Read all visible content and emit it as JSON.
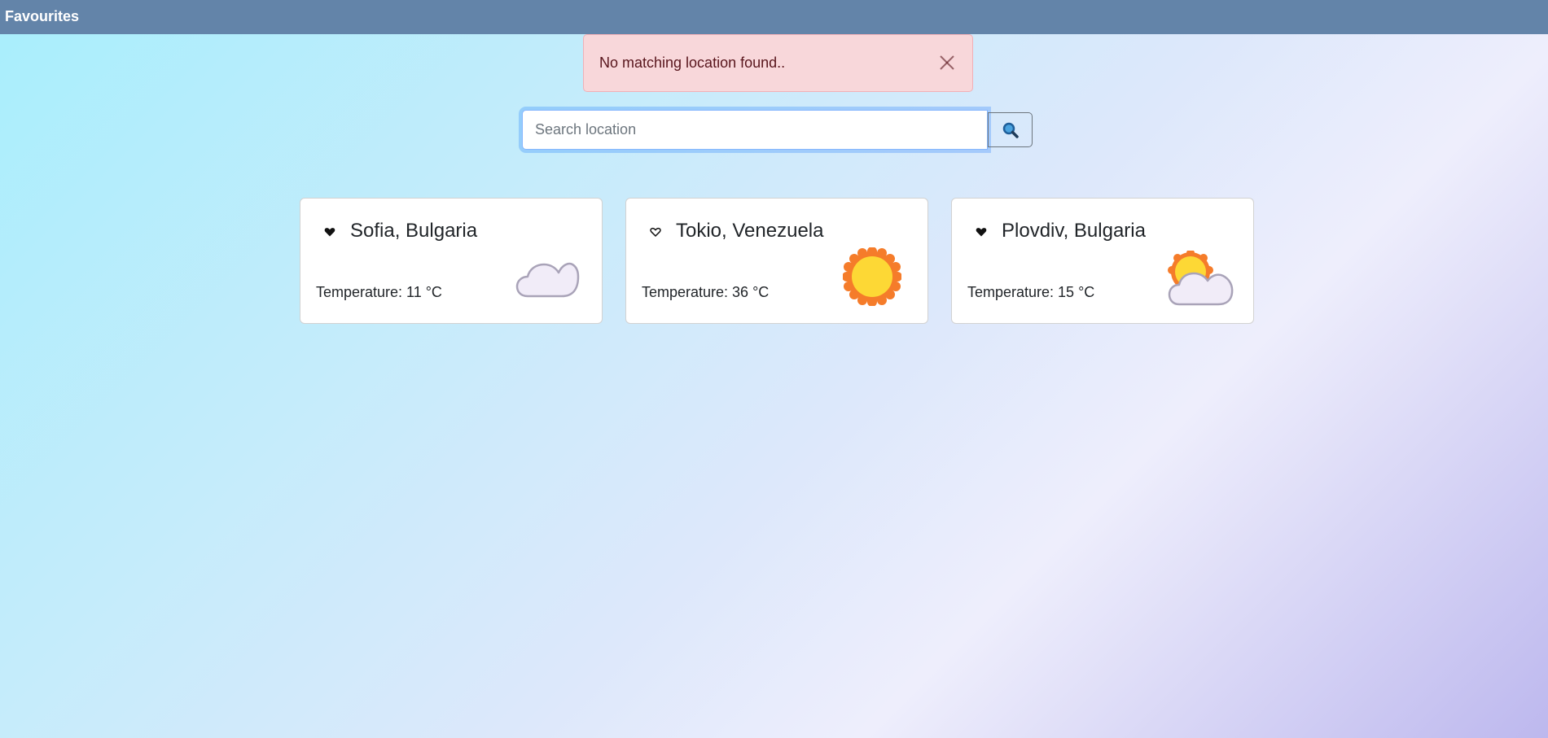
{
  "navbar": {
    "brand": "Favourites"
  },
  "alert": {
    "message": "No matching location found..",
    "close_icon": "close-icon"
  },
  "search": {
    "placeholder": "Search location",
    "value": "",
    "button_icon": "search-icon"
  },
  "cards": [
    {
      "title": "Sofia, Bulgaria",
      "favourite": true,
      "heart_icon": "heart-filled-icon",
      "temperature_text": "Temperature: 11 °C",
      "weather_icon": "cloud-icon"
    },
    {
      "title": "Tokio, Venezuela",
      "favourite": false,
      "heart_icon": "heart-outline-icon",
      "temperature_text": "Temperature: 36 °C",
      "weather_icon": "sun-icon"
    },
    {
      "title": "Plovdiv, Bulgaria",
      "favourite": true,
      "heart_icon": "heart-filled-icon",
      "temperature_text": "Temperature: 15 °C",
      "weather_icon": "partly-cloudy-icon"
    }
  ],
  "colors": {
    "navbar": "#6384a9",
    "alert_bg": "#f8d7da",
    "alert_text": "#58151c",
    "sun_fill": "#fdd835",
    "sun_rays": "#f57c2a",
    "cloud_fill": "#f1ecf8",
    "cloud_stroke": "#a9a3b8"
  }
}
